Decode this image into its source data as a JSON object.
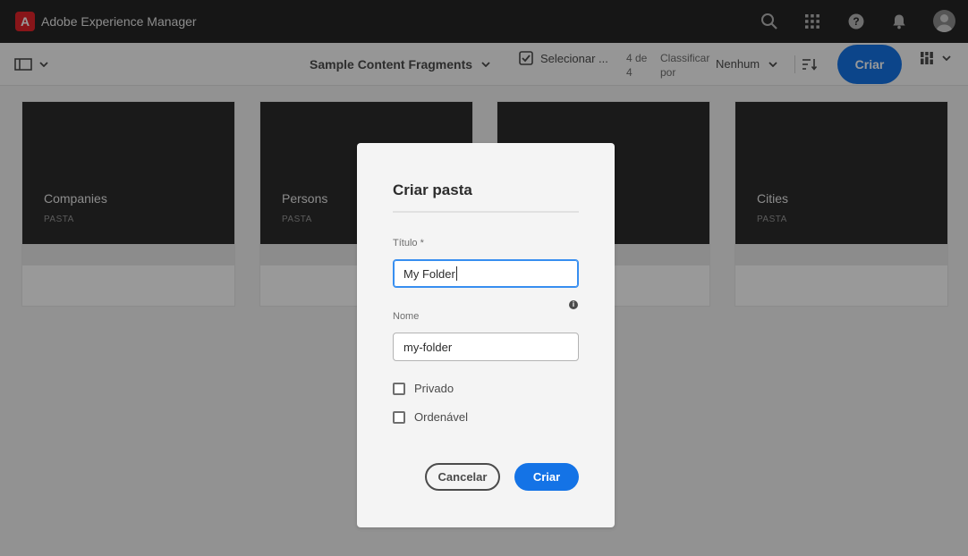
{
  "shell": {
    "brand": "Adobe Experience Manager",
    "logo_letter": "A",
    "icons": [
      "search-icon",
      "apps-grid-icon",
      "help-icon",
      "bell-icon",
      "avatar"
    ]
  },
  "actionbar": {
    "folder_title": "Sample Content Fragments",
    "select_label": "Selecionar ...",
    "count_line1": "4 de",
    "count_line2": "4",
    "sort_label_line1": "Classificar",
    "sort_label_line2": "por",
    "sort_value": "Nenhum",
    "create_label": "Criar"
  },
  "cards": [
    {
      "title": "Companies",
      "type": "PASTA"
    },
    {
      "title": "Persons",
      "type": "PASTA"
    },
    {
      "title": "",
      "type": ""
    },
    {
      "title": "Cities",
      "type": "PASTA"
    }
  ],
  "dialog": {
    "title": "Criar pasta",
    "title_label": "Título *",
    "title_value": "My Folder",
    "name_label": "Nome",
    "name_value": "my-folder",
    "private_label": "Privado",
    "orderable_label": "Ordenável",
    "cancel_label": "Cancelar",
    "create_label": "Criar"
  },
  "colors": {
    "accent": "#1473e6",
    "shell_bg": "#262626",
    "logo_red": "#e3242b"
  }
}
